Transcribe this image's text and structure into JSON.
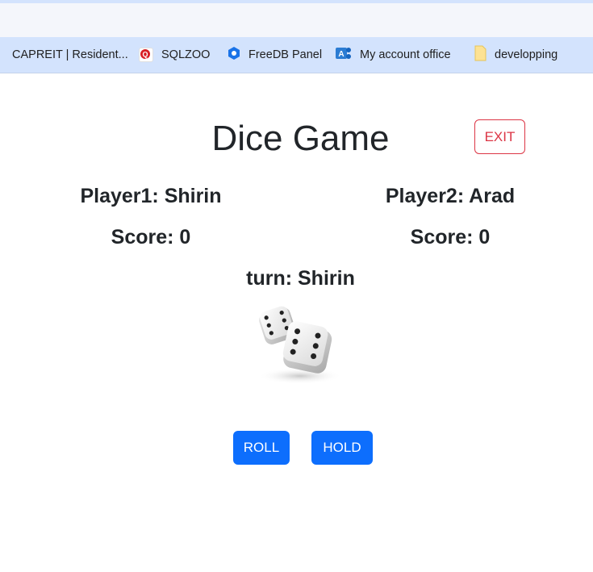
{
  "browser": {
    "bookmarks": [
      {
        "label": "CAPREIT | Resident...",
        "icon": "capreit-icon"
      },
      {
        "label": "SQLZOO",
        "icon": "sqlzoo-icon"
      },
      {
        "label": "FreeDB Panel",
        "icon": "freedb-icon"
      },
      {
        "label": "My account office",
        "icon": "office-icon"
      },
      {
        "label": "developping",
        "icon": "folder-icon"
      }
    ]
  },
  "game": {
    "title": "Dice Game",
    "exit_label": "EXIT",
    "player1_label": "Player1: Shirin",
    "player2_label": "Player2: Arad",
    "player1_score": "Score: 0",
    "player2_score": "Score: 0",
    "turn_label": "turn: Shirin",
    "roll_label": "ROLL",
    "hold_label": "HOLD"
  },
  "colors": {
    "primary": "#0d6efd",
    "danger": "#dc3545",
    "text": "#212529",
    "bookmark_bar": "#d3e3fd"
  }
}
